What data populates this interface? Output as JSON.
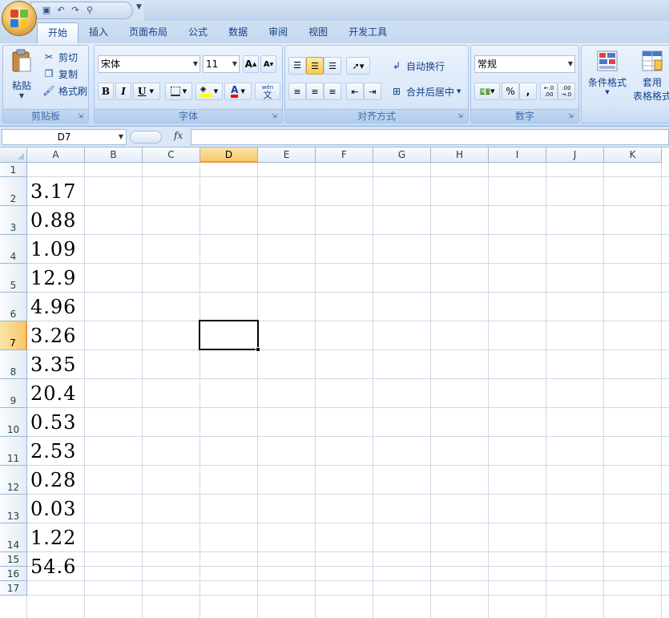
{
  "quick_access": {
    "save_icon": "save-icon",
    "undo_icon": "undo-icon",
    "redo_icon": "redo-icon",
    "preview_icon": "print-preview-icon"
  },
  "tabs": [
    "开始",
    "插入",
    "页面布局",
    "公式",
    "数据",
    "审阅",
    "视图",
    "开发工具"
  ],
  "ribbon": {
    "clipboard": {
      "label": "剪贴板",
      "paste": "粘贴",
      "cut": "剪切",
      "copy": "复制",
      "format_painter": "格式刷"
    },
    "font": {
      "label": "字体",
      "font_name": "宋体",
      "font_size": "11",
      "bold": "B",
      "italic": "I",
      "underline": "U",
      "font_color_letter": "A",
      "phonetic": "wén",
      "phonetic_char": "文"
    },
    "alignment": {
      "label": "对齐方式",
      "wrap_text": "自动换行",
      "merge_center": "合并后居中"
    },
    "number": {
      "label": "数字",
      "format": "常规",
      "percent": "%",
      "comma": ",",
      "inc_decimal_top": "←.0",
      "inc_decimal_bottom": ".00",
      "dec_decimal_top": ".00",
      "dec_decimal_bottom": "→.0"
    },
    "styles": {
      "conditional_format": "条件格式",
      "table_format_line1": "套用",
      "table_format_line2": "表格格式"
    }
  },
  "formula_bar": {
    "name_box": "D7",
    "fx_label": "fx",
    "value": ""
  },
  "sheet": {
    "columns": [
      "A",
      "B",
      "C",
      "D",
      "E",
      "F",
      "G",
      "H",
      "I",
      "J",
      "K"
    ],
    "selected_column": "D",
    "rows": [
      "1",
      "2",
      "3",
      "4",
      "5",
      "6",
      "7",
      "8",
      "9",
      "10",
      "11",
      "12",
      "13",
      "14",
      "15",
      "16",
      "17"
    ],
    "selected_row": "7",
    "column_a_values": [
      "",
      "3.17",
      "0.88",
      "1.09",
      "12.9",
      "4.96",
      "3.26",
      "3.35",
      "20.4",
      "0.53",
      "2.53",
      "0.28",
      "0.03",
      "1.22",
      "54.6",
      "",
      ""
    ]
  }
}
